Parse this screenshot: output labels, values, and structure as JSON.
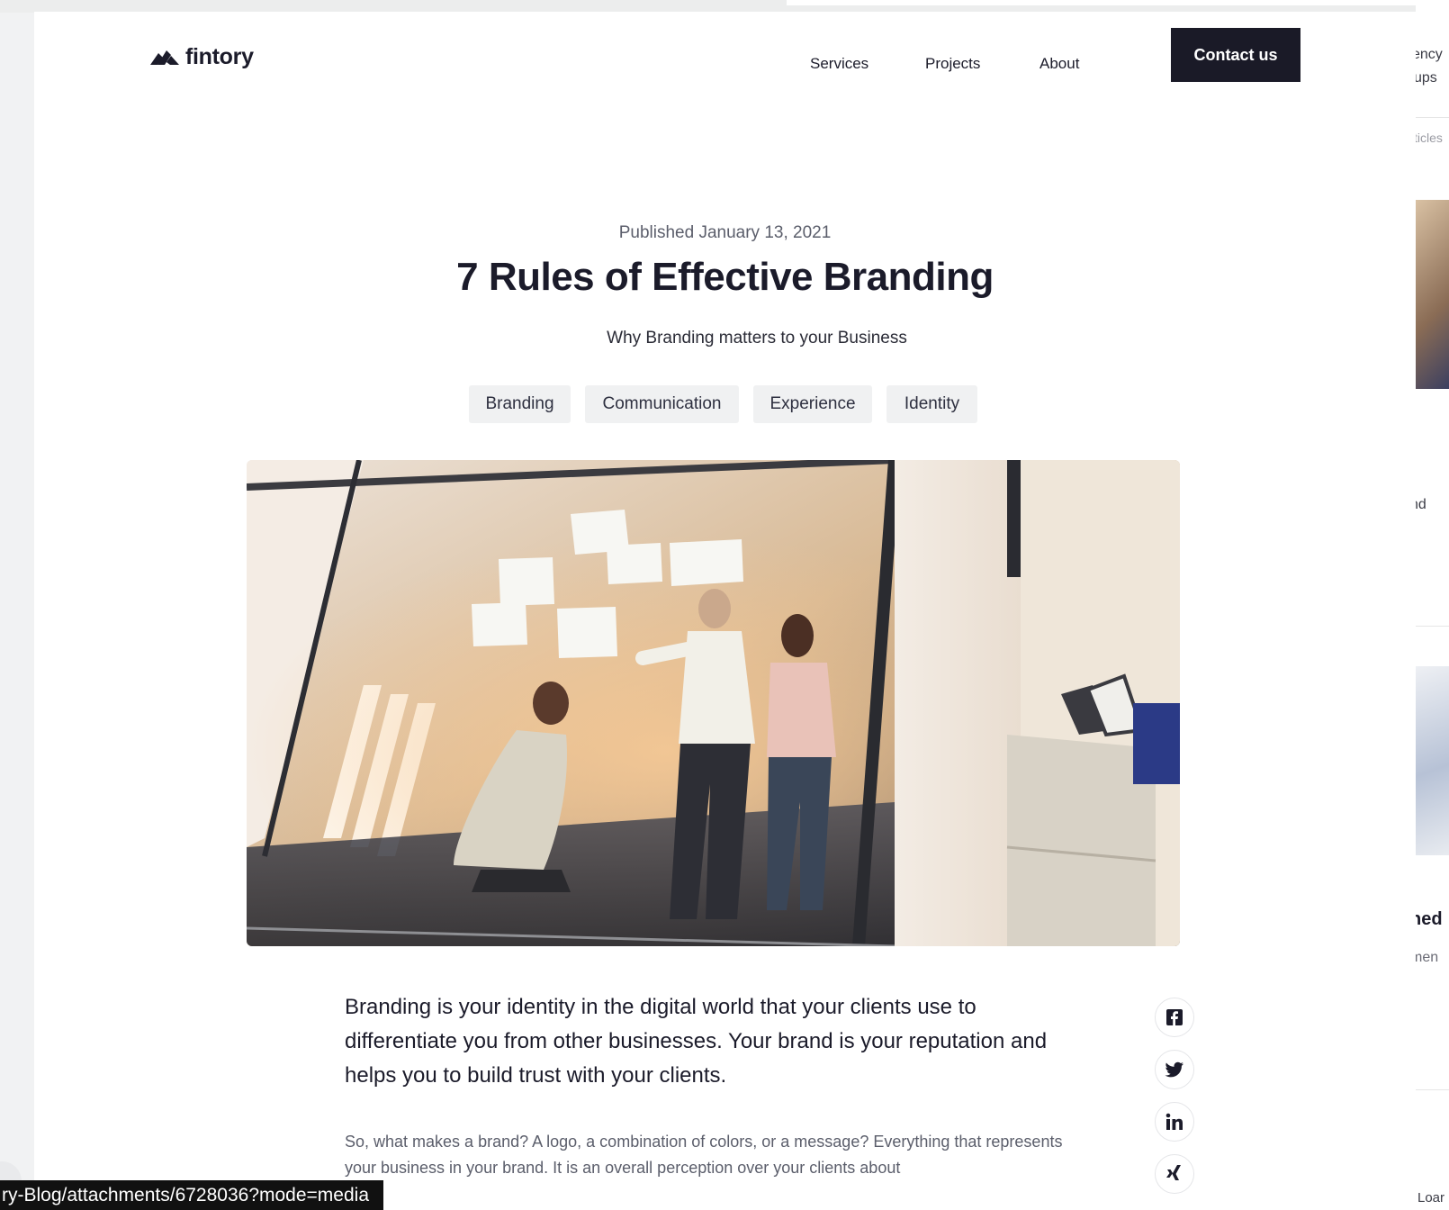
{
  "header": {
    "logo_text": "fintory",
    "nav": [
      "Services",
      "Projects",
      "About"
    ],
    "contact_label": "Contact us"
  },
  "article": {
    "published": "Published January 13, 2021",
    "title": "7 Rules of Effective Branding",
    "subtitle": "Why Branding matters to your Business",
    "tags": [
      "Branding",
      "Communication",
      "Experience",
      "Identity"
    ],
    "lead": "Branding is your identity in the digital world that your clients use to differentiate you from other businesses. Your brand is your reputation and helps you to build trust with your clients.",
    "para": "So, what makes a brand? A logo, a combination of colors, or a message? Everything that represents your business in your brand. It is an overall perception over your clients about"
  },
  "social": [
    "facebook-icon",
    "twitter-icon",
    "linkedin-icon",
    "xing-icon"
  ],
  "background_page": {
    "snippets": [
      "ency",
      "ups",
      "ticles",
      "nd",
      "ned",
      "men",
      "Loar"
    ]
  },
  "status_bar": {
    "url": "ry-Blog/attachments/6728036?mode=media"
  }
}
